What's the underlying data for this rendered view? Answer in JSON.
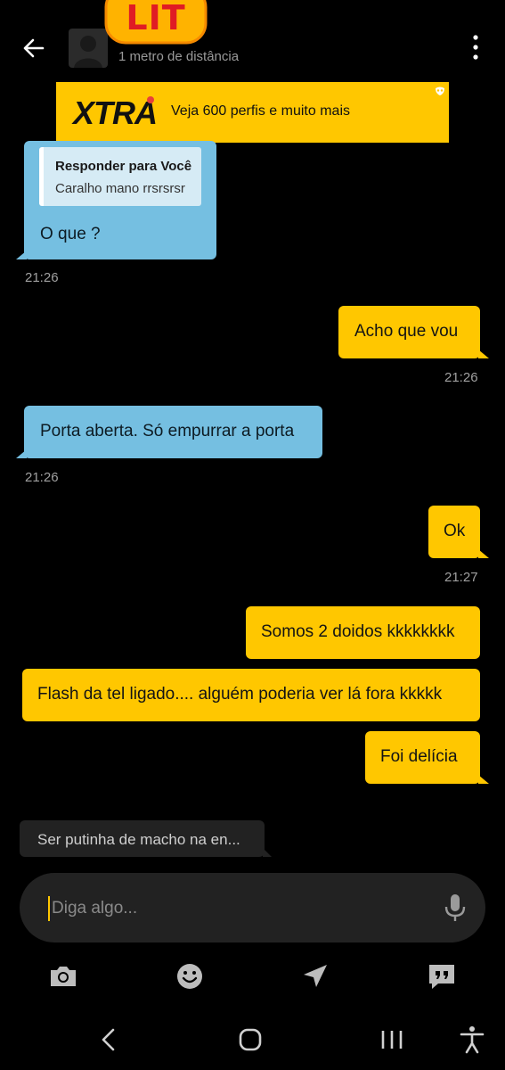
{
  "header": {
    "distance": "1 metro de distância",
    "sticker_label": "LIT",
    "back_icon": "arrow-left-icon",
    "menu_icon": "more-vert-icon"
  },
  "banner": {
    "logo": "XTRA",
    "text": "Veja 600 perfis e muito mais"
  },
  "messages": [
    {
      "side": "left",
      "reply_title": "Responder para Você",
      "reply_text": "Caralho mano rrsrsrsr",
      "text": "O que ?",
      "time": "21:26"
    },
    {
      "side": "right",
      "text": "Acho que vou",
      "time": "21:26"
    },
    {
      "side": "left",
      "text": "Porta aberta. Só empurrar a porta",
      "time": "21:26"
    },
    {
      "side": "right",
      "text": "Ok",
      "time": "21:27"
    },
    {
      "side": "right",
      "text": "Somos 2 doidos kkkkkkkk"
    },
    {
      "side": "right",
      "text": "Flash da tel ligado.... alguém poderia ver lá fora kkkkk"
    },
    {
      "side": "right",
      "text": "Foi delícia"
    }
  ],
  "suggestion": "Ser putinha de macho na en...",
  "input": {
    "placeholder": "Diga algo..."
  },
  "toolbar": [
    "camera-icon",
    "emoji-icon",
    "location-icon",
    "saved-phrases-icon"
  ],
  "nav": [
    "back-nav-icon",
    "home-nav-icon",
    "recents-nav-icon",
    "accessibility-icon"
  ],
  "colors": {
    "accent": "#ffc700",
    "incoming": "#75bfe1",
    "background": "#000000"
  }
}
